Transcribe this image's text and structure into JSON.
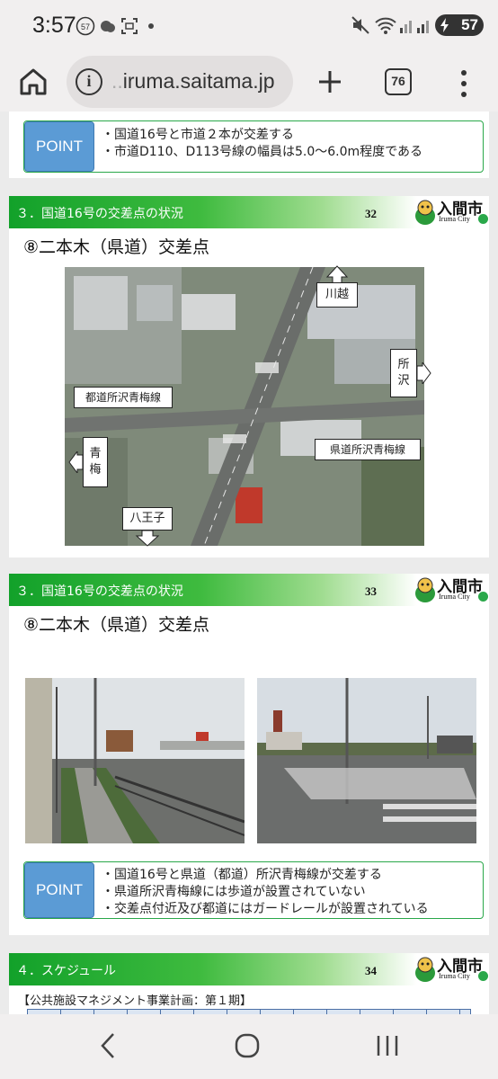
{
  "status_bar": {
    "time": "3:57",
    "notification_badge": "57",
    "battery_percent": "57"
  },
  "browser": {
    "url_dim": "..",
    "url_domain": "iruma.saitama.jp",
    "tab_count": "76"
  },
  "slides": {
    "top_point": {
      "badge": "POINT",
      "items": [
        "国道16号と市道２本が交差する",
        "市道D110、D113号線の幅員は5.0～6.0m程度である"
      ]
    },
    "slide32": {
      "section": "３．国道16号の交差点の状況",
      "page_number": "32",
      "title": "⑧二本木（県道）交差点",
      "map_labels": {
        "kawagoe": "川越",
        "tokorozawa": "所\n沢",
        "toshi_road": "都道所沢青梅線",
        "ome": "青\n梅",
        "ken_road": "県道所沢青梅線",
        "hachioji": "八王子"
      }
    },
    "slide33": {
      "section": "３．国道16号の交差点の状況",
      "page_number": "33",
      "title": "⑧二本木（県道）交差点",
      "point": {
        "badge": "POINT",
        "items": [
          "国道16号と県道（都道）所沢青梅線が交差する",
          "県道所沢青梅線には歩道が設置されていない",
          "交差点付近及び都道にはガードレールが設置されている"
        ]
      }
    },
    "slide34": {
      "section": "４．スケジュール",
      "page_number": "34",
      "subtitle": "【公共施設マネジメント事業計画：第１期】"
    },
    "logo": {
      "text": "入間市",
      "sub": "Iruma City"
    }
  },
  "colors": {
    "accent_green": "#12a12a",
    "point_blue": "#5b9bd5"
  },
  "icons": [
    "home-icon",
    "info-icon",
    "plus-icon",
    "tabs-icon",
    "menu-icon",
    "back-icon",
    "home-nav-icon",
    "recents-icon"
  ]
}
